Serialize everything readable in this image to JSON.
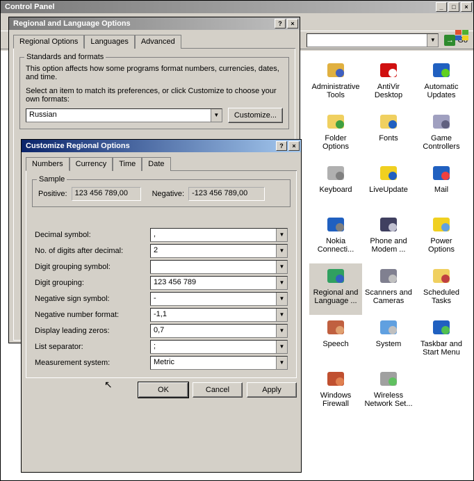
{
  "controlPanel": {
    "title": "Control Panel",
    "goLabel": "Go",
    "items": [
      {
        "label": "Administrative Tools",
        "ico": "#e0b040,#4060c0"
      },
      {
        "label": "AntiVir Desktop",
        "ico": "#d01010,#ffffff"
      },
      {
        "label": "Automatic Updates",
        "ico": "#2060c0,#60d020"
      },
      {
        "label": "Folder Options",
        "ico": "#f0d060,#40a040"
      },
      {
        "label": "Fonts",
        "ico": "#f0d060,#2060c0"
      },
      {
        "label": "Game Controllers",
        "ico": "#a0a0c0,#606080"
      },
      {
        "label": "Keyboard",
        "ico": "#b0b0b0,#808080"
      },
      {
        "label": "LiveUpdate",
        "ico": "#f0d020,#2060c0"
      },
      {
        "label": "Mail",
        "ico": "#2060c0,#f04040"
      },
      {
        "label": "Nokia Connecti...",
        "ico": "#2060c0,#808080"
      },
      {
        "label": "Phone and Modem ...",
        "ico": "#404060,#c0c0d0"
      },
      {
        "label": "Power Options",
        "ico": "#f0d020,#60a0e0"
      },
      {
        "label": "Regional and Language ...",
        "ico": "#30a060,#3060c0",
        "selected": true
      },
      {
        "label": "Scanners and Cameras",
        "ico": "#808090,#c0c0c0"
      },
      {
        "label": "Scheduled Tasks",
        "ico": "#f0d060,#c04040"
      },
      {
        "label": "Speech",
        "ico": "#c06040,#e0a070"
      },
      {
        "label": "System",
        "ico": "#60a0e0,#c0c0c0"
      },
      {
        "label": "Taskbar and Start Menu",
        "ico": "#2060c0,#50c050"
      },
      {
        "label": "Windows Firewall",
        "ico": "#c05030,#e08050"
      },
      {
        "label": "Wireless Network Set...",
        "ico": "#a0a0a0,#60c060"
      }
    ]
  },
  "regionalDlg": {
    "title": "Regional and Language Options",
    "tabs": [
      "Regional Options",
      "Languages",
      "Advanced"
    ],
    "activeTab": 0,
    "standards": {
      "legend": "Standards and formats",
      "desc1": "This option affects how some programs format numbers, currencies, dates, and time.",
      "desc2": "Select an item to match its preferences, or click Customize to choose your own formats:",
      "value": "Russian",
      "customizeBtn": "Customize..."
    }
  },
  "customizeDlg": {
    "title": "Customize Regional Options",
    "tabs": [
      "Numbers",
      "Currency",
      "Time",
      "Date"
    ],
    "activeTab": 0,
    "sample": {
      "legend": "Sample",
      "positiveLabel": "Positive:",
      "positiveVal": "123 456 789,00",
      "negativeLabel": "Negative:",
      "negativeVal": "-123 456 789,00"
    },
    "fields": [
      {
        "label": "Decimal symbol:",
        "value": ","
      },
      {
        "label": "No. of digits after decimal:",
        "value": "2"
      },
      {
        "label": "Digit grouping symbol:",
        "value": ""
      },
      {
        "label": "Digit grouping:",
        "value": "123 456 789"
      },
      {
        "label": "Negative sign symbol:",
        "value": "-"
      },
      {
        "label": "Negative number format:",
        "value": "-1,1"
      },
      {
        "label": "Display leading zeros:",
        "value": "0,7"
      },
      {
        "label": "List separator:",
        "value": ";"
      },
      {
        "label": "Measurement system:",
        "value": "Metric"
      }
    ],
    "buttons": {
      "ok": "OK",
      "cancel": "Cancel",
      "apply": "Apply"
    }
  }
}
